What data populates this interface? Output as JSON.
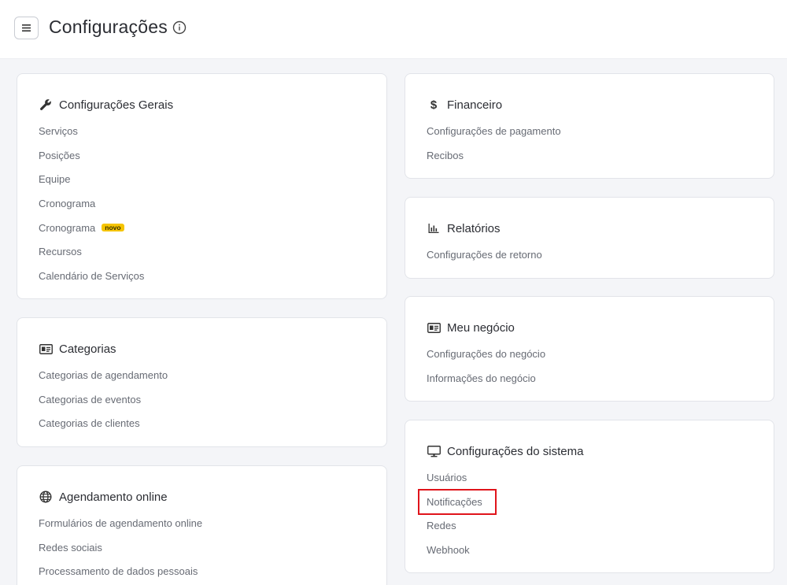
{
  "header": {
    "title": "Configurações"
  },
  "cards": {
    "general": {
      "title": "Configurações Gerais",
      "items": [
        "Serviços",
        "Posições",
        "Equipe",
        "Cronograma",
        "Cronograma",
        "Recursos",
        "Calendário de Serviços"
      ],
      "badge": "novo"
    },
    "categories": {
      "title": "Categorias",
      "items": [
        "Categorias de agendamento",
        "Categorias de eventos",
        "Categorias de clientes"
      ]
    },
    "online": {
      "title": "Agendamento online",
      "items": [
        "Formulários de agendamento online",
        "Redes sociais",
        "Processamento de dados pessoais"
      ]
    },
    "finance": {
      "title": "Financeiro",
      "items": [
        "Configurações de pagamento",
        "Recibos"
      ]
    },
    "reports": {
      "title": "Relatórios",
      "items": [
        "Configurações de retorno"
      ]
    },
    "business": {
      "title": "Meu negócio",
      "items": [
        "Configurações do negócio",
        "Informações do negócio"
      ]
    },
    "system": {
      "title": "Configurações do sistema",
      "items": [
        "Usuários",
        "Notificações",
        "Redes",
        "Webhook"
      ]
    }
  },
  "colors": {
    "badge": "#f5c400",
    "highlight": "#e0141b",
    "background": "#f4f5f8"
  },
  "icons": {
    "menu": "hamburger-icon",
    "info": "info-icon",
    "general": "wrench-icon",
    "categories": "id-card-icon",
    "online": "globe-icon",
    "finance": "dollar-icon",
    "reports": "bar-chart-icon",
    "business": "id-card-icon",
    "system": "monitor-icon"
  }
}
